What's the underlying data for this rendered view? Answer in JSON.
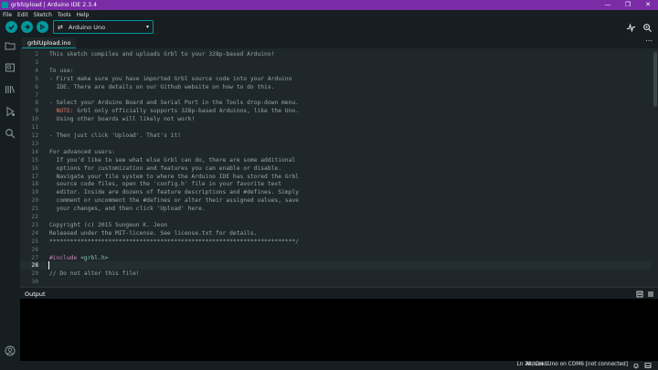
{
  "window": {
    "title": "grblUpload | Arduino IDE 2.3.4",
    "minimize": "—",
    "maximize": "❐",
    "close": "✕"
  },
  "menu": [
    "File",
    "Edit",
    "Sketch",
    "Tools",
    "Help"
  ],
  "toolbar": {
    "board": "Arduino Uno",
    "chevron": "▾"
  },
  "tabs": {
    "active": "grblUpload.ino",
    "more": "⋯"
  },
  "editor": {
    "lines": [
      {
        "n": "2",
        "t": "This sketch compiles and uploads Grbl to your 328p-based Arduino!"
      },
      {
        "n": "3",
        "t": ""
      },
      {
        "n": "4",
        "t": "To use:"
      },
      {
        "n": "5",
        "t": "- First make sure you have imported Grbl source code into your Arduino"
      },
      {
        "n": "6",
        "t": "  IDE. There are details on our Github website on how to do this."
      },
      {
        "n": "7",
        "t": ""
      },
      {
        "n": "8",
        "t": "- Select your Arduino Board and Serial Port in the Tools drop-down menu."
      },
      {
        "n": "9",
        "note": "  NOTE:",
        "t": " Grbl only officially supports 328p-based Arduinos, like the Uno."
      },
      {
        "n": "10",
        "t": "  Using other boards will likely not work!"
      },
      {
        "n": "11",
        "t": ""
      },
      {
        "n": "12",
        "t": "- Then just click 'Upload'. That's it!"
      },
      {
        "n": "13",
        "t": ""
      },
      {
        "n": "14",
        "t": "For advanced users:"
      },
      {
        "n": "15",
        "t": "  If you'd like to see what else Grbl can do, there are some additional"
      },
      {
        "n": "16",
        "t": "  options for customization and features you can enable or disable."
      },
      {
        "n": "17",
        "t": "  Navigate your file system to where the Arduino IDE has stored the Grbl"
      },
      {
        "n": "18",
        "t": "  source code files, open the 'config.h' file in your favorite text"
      },
      {
        "n": "19",
        "t": "  editor. Inside are dozens of feature descriptions and #defines. Simply"
      },
      {
        "n": "20",
        "t": "  comment or uncomment the #defines or alter their assigned values, save"
      },
      {
        "n": "21",
        "t": "  your changes, and then click 'Upload' here."
      },
      {
        "n": "22",
        "t": ""
      },
      {
        "n": "23",
        "t": "Copyright (c) 2015 Sungeun K. Jeon"
      },
      {
        "n": "24",
        "t": "Released under the MIT-license. See license.txt for details."
      },
      {
        "n": "25",
        "t": "***********************************************************************/"
      },
      {
        "n": "26",
        "t": ""
      },
      {
        "n": "27",
        "inc": "#include",
        "hdr": " <grbl.h>",
        "t": ""
      },
      {
        "n": "28",
        "t": "",
        "active": true
      },
      {
        "n": "29",
        "t": "// Do not alter this file!"
      },
      {
        "n": "30",
        "t": ""
      }
    ]
  },
  "output": {
    "title": "Output"
  },
  "status": {
    "position": "Ln 28, Col 1",
    "board": "Arduino Uno on COM6 [not connected]"
  },
  "icons": {
    "verify": "check-icon",
    "upload": "arrow-right-icon",
    "debug": "debug-icon",
    "serial_plotter": "pulse-icon",
    "serial_monitor": "magnifier-icon"
  },
  "colors": {
    "titlebar": "#7a2ca6",
    "accent": "#00979d",
    "editor_bg": "#1f272a",
    "output_bg": "#000000"
  }
}
